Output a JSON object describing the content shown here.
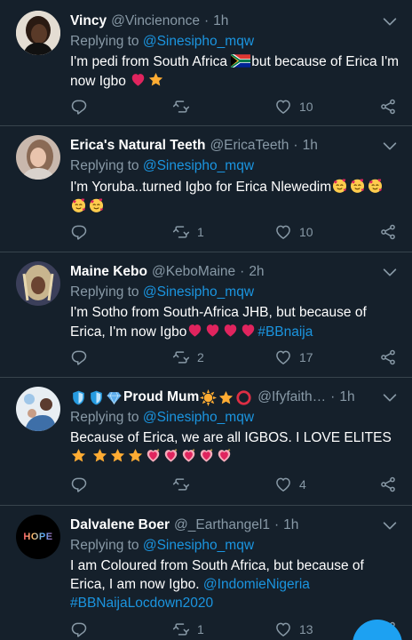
{
  "tweets": [
    {
      "name": "Vincy",
      "handle": "@Vincienonce",
      "separator": "·",
      "time": "1h",
      "reply_prefix": "Replying to",
      "reply_to": "@Sinesipho_mqw",
      "text_a": "I'm pedi from South Africa ",
      "text_b": "but because of Erica I'm now Igbo",
      "reply_count": "",
      "retweet_count": "",
      "like_count": "10"
    },
    {
      "name": "Erica's Natural Teeth",
      "handle": "@EricaTeeth",
      "separator": "·",
      "time": "1h",
      "reply_prefix": "Replying to",
      "reply_to": "@Sinesipho_mqw",
      "text_a": "I'm Yoruba..turned Igbo for Erica Nlewedim",
      "reply_count": "",
      "retweet_count": "1",
      "like_count": "10"
    },
    {
      "name": "Maine Kebo",
      "handle": "@KeboMaine",
      "separator": "·",
      "time": "2h",
      "reply_prefix": "Replying to",
      "reply_to": "@Sinesipho_mqw",
      "text_a": "I'm Sotho from South-Africa JHB, but because of Erica, I'm now Igbo",
      "hashtag": "#BBnaija",
      "reply_count": "",
      "retweet_count": "2",
      "like_count": "17"
    },
    {
      "name": "Proud Mum",
      "handle": "@Ifyfaith…",
      "separator": "·",
      "time": "1h",
      "reply_prefix": "Replying to",
      "reply_to": "@Sinesipho_mqw",
      "text_a": "Because of Erica, we are all IGBOS. I LOVE ELITES",
      "reply_count": "",
      "retweet_count": "",
      "like_count": "4"
    },
    {
      "name": "Dalvalene Boer",
      "handle": "@_Earthangel1",
      "separator": "·",
      "time": "1h",
      "reply_prefix": "Replying to",
      "reply_to": "@Sinesipho_mqw",
      "text_a": "I am Coloured from South Africa, but because of Erica,  I am now Igbo. ",
      "mention": "@IndomieNigeria",
      "hashtag": "#BBNaijaLocdown2020",
      "avatar_text": "HOPE",
      "reply_count": "",
      "retweet_count": "1",
      "like_count": "13"
    }
  ],
  "colors": {
    "background": "#15202b",
    "divider": "#38444d",
    "muted": "#8899a6",
    "link": "#1b95e0",
    "accent": "#1da1f2"
  },
  "icons": {
    "reply": "reply-icon",
    "retweet": "retweet-icon",
    "like": "heart-icon",
    "share": "share-icon",
    "menu": "chevron-down-icon",
    "compose": "compose-fab"
  }
}
